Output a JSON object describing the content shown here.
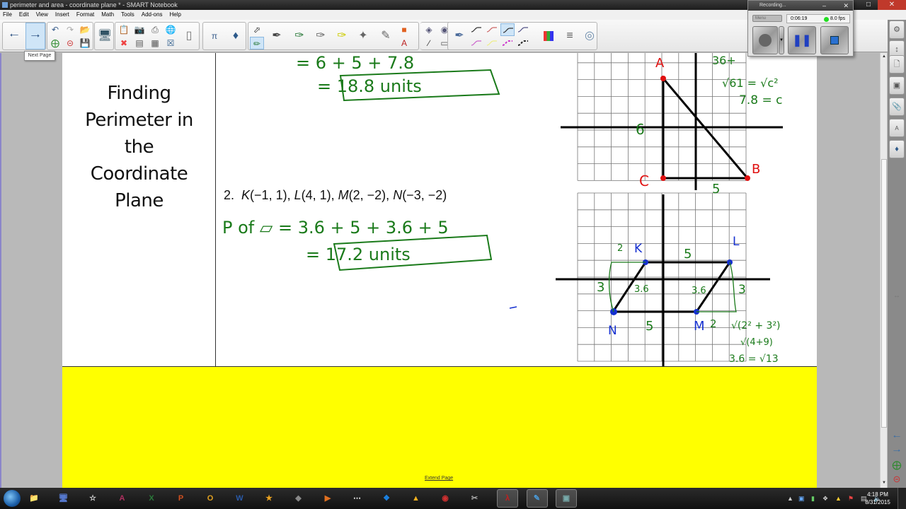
{
  "window": {
    "title": "perimeter and area - coordinate plane * - SMART Notebook",
    "controls": [
      "minimize",
      "maximize",
      "close"
    ]
  },
  "menu": [
    "File",
    "Edit",
    "View",
    "Insert",
    "Format",
    "Math",
    "Tools",
    "Add-ons",
    "Help"
  ],
  "toolbar": {
    "tooltip": "Next Page",
    "groups": [
      {
        "name": "navigation",
        "tools": [
          "previous-page",
          "next-page"
        ]
      },
      {
        "name": "edit",
        "tools": [
          "undo",
          "redo",
          "open",
          "add-page",
          "delete-page",
          "save"
        ]
      },
      {
        "name": "view",
        "tools": [
          "screen-display"
        ]
      },
      {
        "name": "insert",
        "tools": [
          "paste",
          "screen-capture",
          "document-camera",
          "table-insert",
          "delete",
          "screen-shade",
          "table",
          "full-screen",
          "dual-page"
        ]
      },
      {
        "name": "math",
        "tools": [
          "math-tools",
          "add-ons"
        ]
      },
      {
        "name": "drawing",
        "tools": [
          "select",
          "multi-pens",
          "pen",
          "creative-pen",
          "calligraphic-pen",
          "highlighter",
          "magic-pen",
          "shape-recognition",
          "shapes",
          "fill",
          "lines",
          "text",
          "line",
          "eraser"
        ]
      },
      {
        "name": "properties",
        "tools": [
          "pen-type",
          "line-styles",
          "color-palette",
          "line-thickness",
          "transparency"
        ]
      }
    ]
  },
  "recorder": {
    "title": "Recording...",
    "menu_label": "Menu",
    "time": "0:06:19",
    "fps": "8.0 fps",
    "status_color": "#22dd22",
    "buttons": [
      "record",
      "pause",
      "stop"
    ]
  },
  "page": {
    "title_lines": [
      "Finding",
      "Perimeter in",
      "the",
      "Coordinate",
      "Plane"
    ],
    "problem_2": {
      "number": "2.",
      "points": [
        {
          "label": "K",
          "coords": "(−1, 1)"
        },
        {
          "label": "L",
          "coords": "(4, 1)"
        },
        {
          "label": "M",
          "coords": "(2, −2)"
        },
        {
          "label": "N",
          "coords": "(−3, −2)"
        }
      ]
    },
    "handwriting": {
      "problem_1_sum": "= 6 + 5 + 7.8",
      "problem_1_answer": "= 18.8 units",
      "problem_2_sum": "P of ▱ = 3.6 + 5 + 3.6 + 5",
      "problem_2_answer": "= 17.2 units",
      "triangle_notes": [
        "36+",
        "√61 = √c²",
        "7.8 = c"
      ],
      "triangle_labels": {
        "A": "A",
        "B": "B",
        "C": "C",
        "side_vertical": "6",
        "side_horizontal": "5"
      },
      "parallelogram_labels": {
        "K": "K",
        "L": "L",
        "M": "M",
        "N": "N",
        "top": "5",
        "bottom": "5",
        "left_run": "2",
        "left_rise": "3",
        "right_rise": "3",
        "right_run": "2",
        "diag_left": "3.6",
        "diag_right": "3.6"
      },
      "parallelogram_notes": [
        "√(2² + 3²)",
        "√(4+9)",
        "3.6 = √13"
      ]
    },
    "extend_link": "Extend Page",
    "ink_colors": {
      "green": "#1a7a1a",
      "red": "#e01010",
      "blue": "#1530d0",
      "black": "#000000"
    },
    "yellow_fill": "#ffff00"
  },
  "side_tabs": [
    "page-sorter",
    "gallery",
    "attachments",
    "properties",
    "add-ons"
  ],
  "side_nav": [
    "previous-page",
    "next-page",
    "add-page",
    "delete-page"
  ],
  "taskbar": {
    "apps": [
      "file-explorer",
      "remote-desktop",
      "notepad-rabbit",
      "access",
      "excel",
      "powerpoint",
      "outlook",
      "word",
      "smart-ink",
      "inkscape",
      "media-player",
      "launcher",
      "dropbox",
      "google-drive",
      "chrome",
      "snipping-tool",
      "acrobat",
      "smart-notebook",
      "recorder"
    ],
    "clock_time": "4:18 PM",
    "clock_date": "8/31/2015"
  }
}
